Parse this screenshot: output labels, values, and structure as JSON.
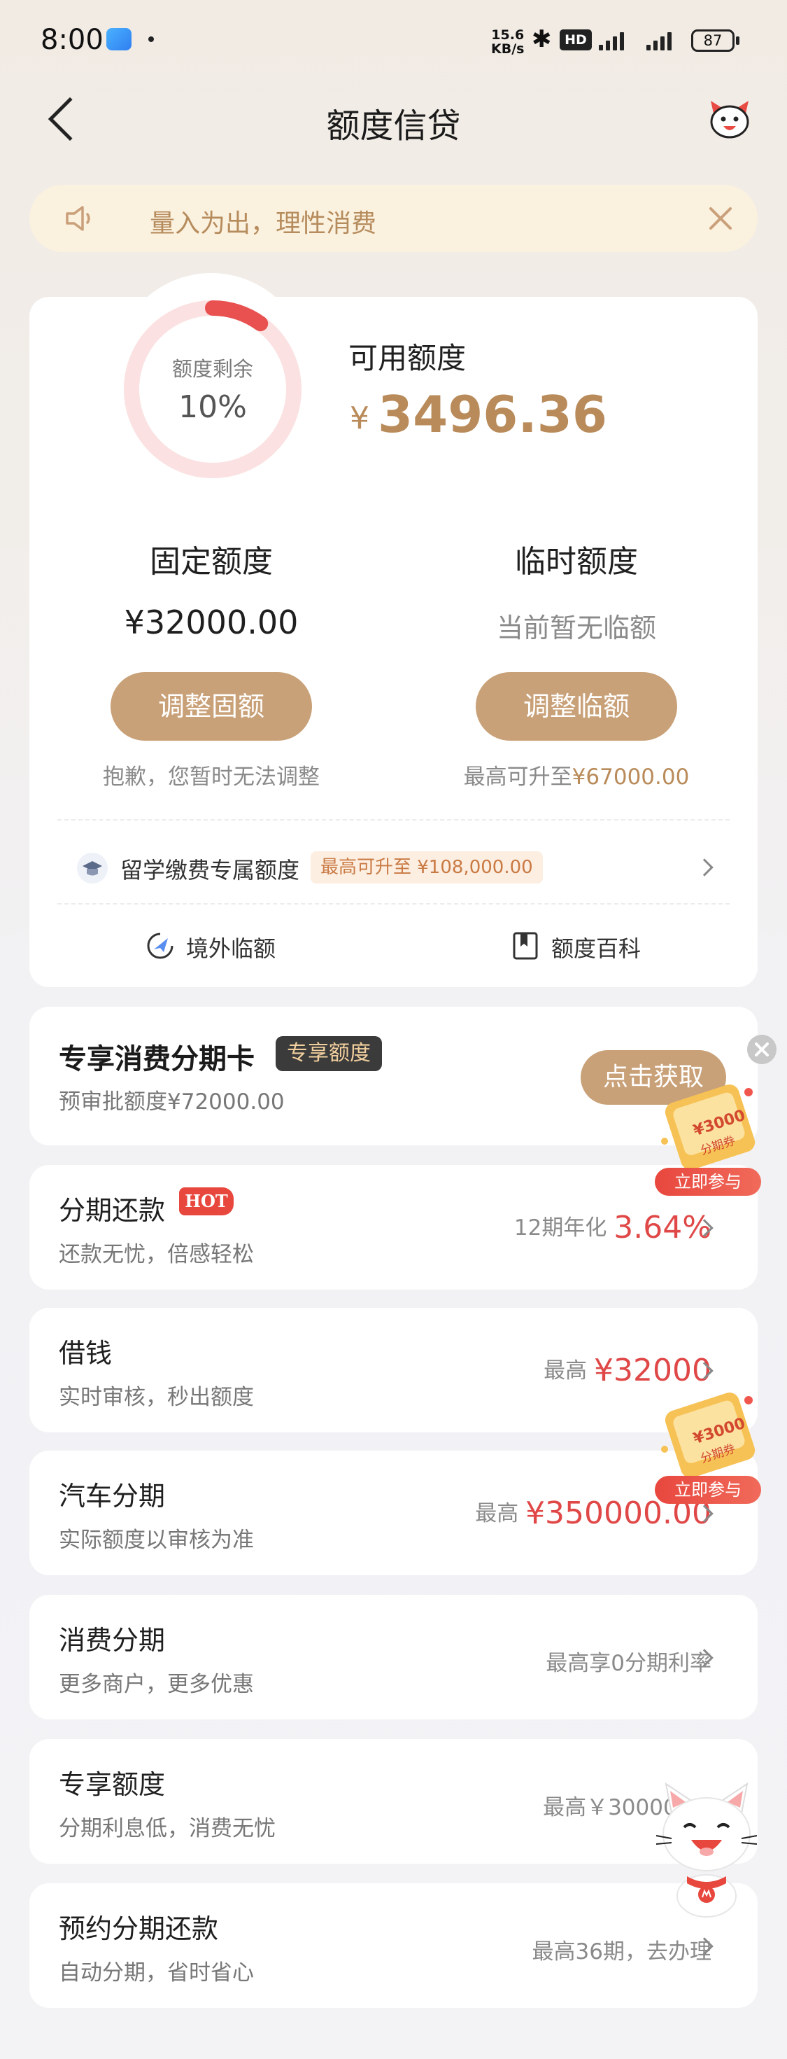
{
  "status_bar": {
    "time": "8:00",
    "speed_value": "15.6",
    "speed_unit": "KB/s",
    "hd": "HD",
    "battery": "87",
    "icons": [
      "weather-app-icon",
      "bluetooth-icon",
      "signal-icon",
      "battery-icon"
    ]
  },
  "header": {
    "title": "额度信贷",
    "back_icon": "chevron-left-icon",
    "right_icon": "mascot-icon"
  },
  "notice": {
    "text": "量入为出，理性消费",
    "icon": "speaker-icon",
    "close_icon": "close-icon"
  },
  "credit": {
    "ring_label": "额度剩余",
    "ring_percent_text": "10%",
    "remaining_fraction": 0.1,
    "available_label": "可用额度",
    "currency": "¥",
    "available_amount": "3496.36",
    "fixed": {
      "title": "固定额度",
      "amount": "¥32000.00",
      "button": "调整固额",
      "note": "抱歉，您暂时无法调整"
    },
    "temporary": {
      "title": "临时额度",
      "status": "当前暂无临额",
      "button": "调整临额",
      "note_prefix": "最高可升至",
      "note_amount": "¥67000.00"
    },
    "study": {
      "label": "留学缴费专属额度",
      "badge": "最高可升至 ¥108,000.00"
    },
    "tools": [
      {
        "label": "境外临额",
        "icon": "plane-icon"
      },
      {
        "label": "额度百科",
        "icon": "book-icon"
      }
    ]
  },
  "promo": {
    "title": "专享消费分期卡",
    "badge": "专享额度",
    "subtitle": "预审批额度¥72000.00",
    "button": "点击获取"
  },
  "coupon": {
    "amount": "¥3000",
    "label": "分期券",
    "button": "立即参与"
  },
  "rows": [
    {
      "title": "分期还款",
      "badge": "HOT",
      "subtitle": "还款无忧，倍感轻松",
      "right_prefix": "12期年化",
      "right_value": "3.64%"
    },
    {
      "title": "借钱",
      "subtitle": "实时审核，秒出额度",
      "right_prefix": "最高",
      "right_value": "¥32000"
    },
    {
      "title": "汽车分期",
      "subtitle": "实际额度以审核为准",
      "right_prefix": "最高",
      "right_value": "¥350000.00"
    },
    {
      "title": "消费分期",
      "subtitle": "更多商户，更多优惠",
      "right_text": "最高享0分期利率"
    },
    {
      "title": "专享额度",
      "subtitle": "分期利息低，消费无忧",
      "right_text": "最高￥300000.0"
    },
    {
      "title": "预约分期还款",
      "subtitle": "自动分期，省时省心",
      "right_text": "最高36期，去办理"
    }
  ],
  "colors": {
    "accent_gold": "#c9a178",
    "amount_gold": "#b98b5a",
    "highlight_red": "#e04848",
    "ring_track": "#fbe1e1",
    "ring_fill": "#e8514f"
  }
}
